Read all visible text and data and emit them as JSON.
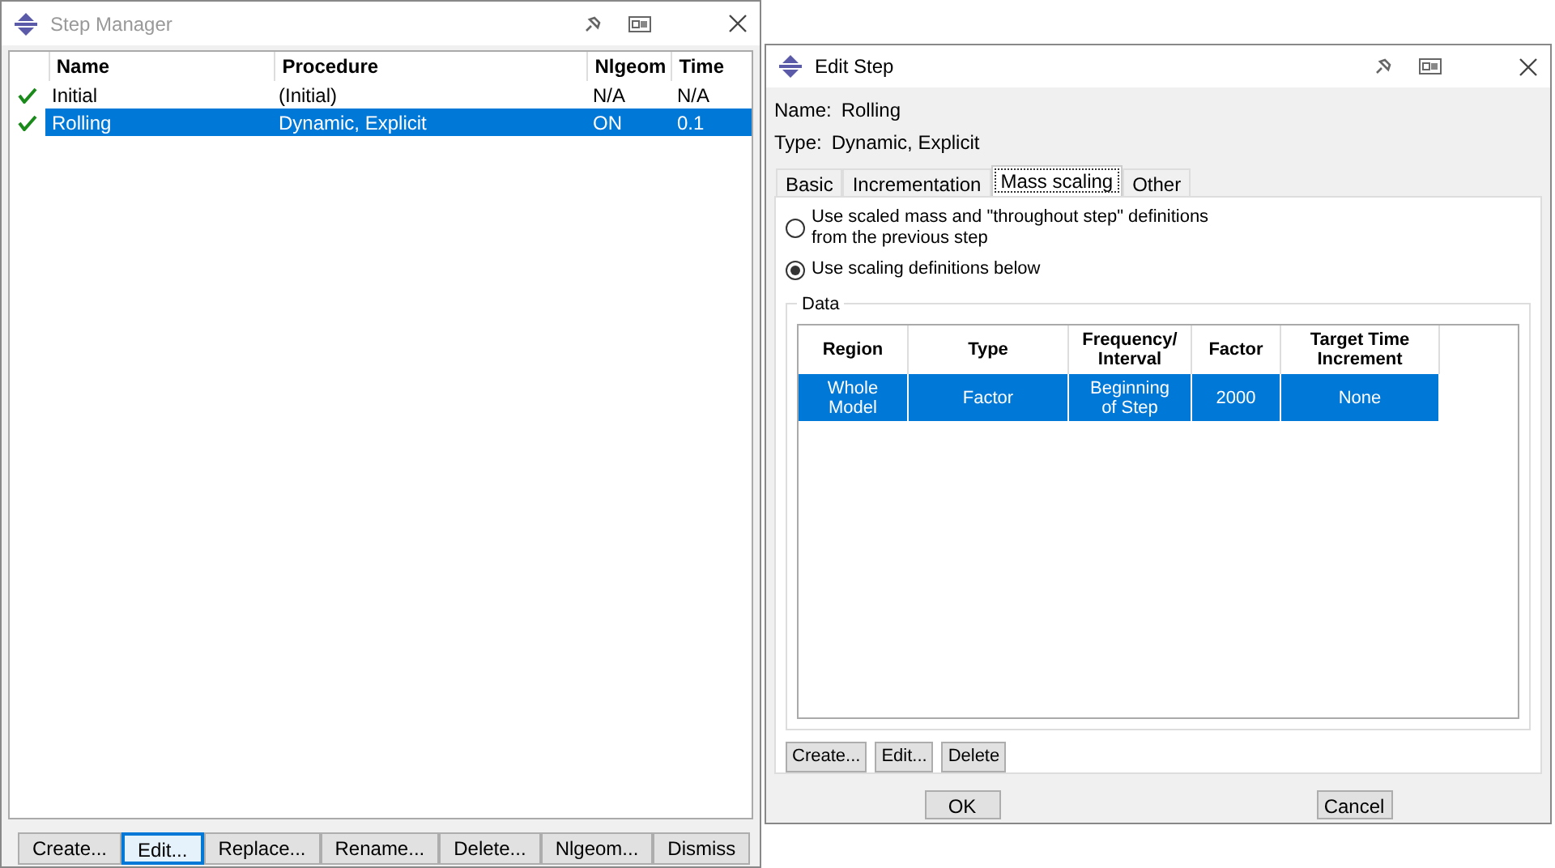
{
  "step_manager": {
    "title": "Step Manager",
    "columns": [
      "Name",
      "Procedure",
      "Nlgeom",
      "Time"
    ],
    "rows": [
      {
        "checked": true,
        "selected": false,
        "cells": [
          "Initial",
          "(Initial)",
          "N/A",
          "N/A"
        ]
      },
      {
        "checked": true,
        "selected": true,
        "cells": [
          "Rolling",
          "Dynamic, Explicit",
          "ON",
          "0.1"
        ]
      }
    ],
    "buttons": [
      {
        "label": "Create...",
        "selected": false
      },
      {
        "label": "Edit...",
        "selected": true
      },
      {
        "label": "Replace...",
        "selected": false
      },
      {
        "label": "Rename...",
        "selected": false
      },
      {
        "label": "Delete...",
        "selected": false
      },
      {
        "label": "Nlgeom...",
        "selected": false
      },
      {
        "label": "Dismiss",
        "selected": false
      }
    ]
  },
  "edit_step": {
    "title": "Edit Step",
    "name_label": "Name:",
    "name": "Rolling",
    "type_label": "Type:",
    "type": "Dynamic, Explicit",
    "tabs": [
      {
        "label": "Basic",
        "selected": false
      },
      {
        "label": "Incrementation",
        "selected": false
      },
      {
        "label": "Mass scaling",
        "selected": true
      },
      {
        "label": "Other",
        "selected": false
      }
    ],
    "options": [
      {
        "label": "Use scaled mass and \"throughout step\" definitions\nfrom the previous step",
        "selected": false
      },
      {
        "label": "Use scaling definitions below",
        "selected": true
      }
    ],
    "group_title": "Data",
    "columns": [
      "Region",
      "Type",
      "Frequency/\nInterval",
      "Factor",
      "Target Time\nIncrement"
    ],
    "rows": [
      {
        "selected": true,
        "cells": [
          "Whole\nModel",
          "Factor",
          "Beginning\nof Step",
          "2000",
          "None"
        ]
      }
    ],
    "table_buttons": [
      "Create...",
      "Edit...",
      "Delete"
    ],
    "buttons": [
      "OK",
      "Cancel"
    ]
  }
}
